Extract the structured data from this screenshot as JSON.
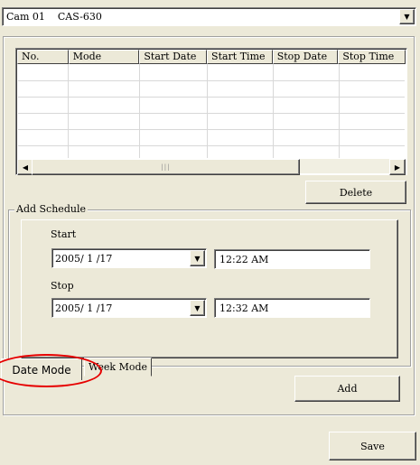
{
  "camera_select": {
    "value": "Cam 01    CAS-630"
  },
  "schedule_table": {
    "columns": [
      "No.",
      "Mode",
      "Start Date",
      "Start Time",
      "Stop Date",
      "Stop Time"
    ],
    "rows": []
  },
  "buttons": {
    "delete": "Delete",
    "add": "Add",
    "save": "Save"
  },
  "add_schedule": {
    "group_label": "Add Schedule",
    "start_label": "Start",
    "start_date": "2005/ 1 /17",
    "start_time": "12:22 AM",
    "stop_label": "Stop",
    "stop_date": "2005/ 1 /17",
    "stop_time": "12:32 AM"
  },
  "tabs": [
    {
      "label": "Date Mode",
      "active": true
    },
    {
      "label": "Week Mode",
      "active": false
    }
  ],
  "annotation": {
    "color": "#e60000",
    "target": "Date Mode"
  },
  "icons": {
    "dropdown": "chevron-down-icon",
    "scroll_left": "arrow-left-icon",
    "scroll_right": "arrow-right-icon"
  }
}
